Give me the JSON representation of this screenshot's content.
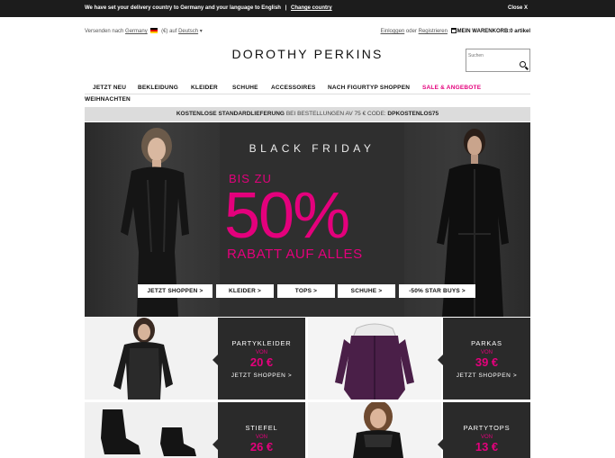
{
  "notice": {
    "message": "We have set your delivery country to Germany and your language to English",
    "separator": "|",
    "change_link": "Change country",
    "close": "Close X"
  },
  "utility": {
    "ship_prefix": "Versenden nach",
    "ship_country": "Germany",
    "currency_lang": "(€) auf",
    "language": "Deutsch",
    "dropdown_arrow": "▾",
    "login": "Einloggen",
    "or": "oder",
    "register": "Registrieren",
    "cart": "MEIN WARENKORB:0 artikel"
  },
  "logo": "DOROTHY PERKINS",
  "search": {
    "placeholder": "Suchen"
  },
  "nav": {
    "items": [
      "JETZT NEU",
      "BEKLEIDUNG",
      "KLEIDER",
      "SCHUHE",
      "ACCESSOIRES",
      "NACH FIGURTYP SHOPPEN",
      "SALE & ANGEBOTE"
    ],
    "second_row": "WEIHNACHTEN"
  },
  "promo": {
    "lead": "KOSTENLOSE STANDARDLIEFERUNG",
    "mid": "BEI BESTELLUNGEN AV 75 € CODE:",
    "code": "DPKOSTENLOS75"
  },
  "hero": {
    "headline": "BLACK FRIDAY",
    "upto": "BIS ZU",
    "percent": "50%",
    "subline": "RABATT AUF ALLES",
    "buttons": [
      "JETZT SHOPPEN >",
      "KLEIDER >",
      "TOPS >",
      "SCHUHE >",
      "-50% STAR BUYS >"
    ]
  },
  "tiles": [
    {
      "title": "PARTYKLEIDER",
      "von": "VON",
      "price": "20 €",
      "cta": "JETZT SHOPPEN >"
    },
    {
      "title": "PARKAS",
      "von": "VON",
      "price": "39 €",
      "cta": "JETZT SHOPPEN >"
    },
    {
      "title": "STIEFEL",
      "von": "VON",
      "price": "26 €"
    },
    {
      "title": "PARTYTOPS",
      "von": "VON",
      "price": "13 €"
    }
  ],
  "colors": {
    "accent_pink": "#e4007c",
    "notice_bar": "#1c1c1c",
    "panel_dark": "#2a2a2a",
    "promo_grey": "#dcdcdc"
  }
}
